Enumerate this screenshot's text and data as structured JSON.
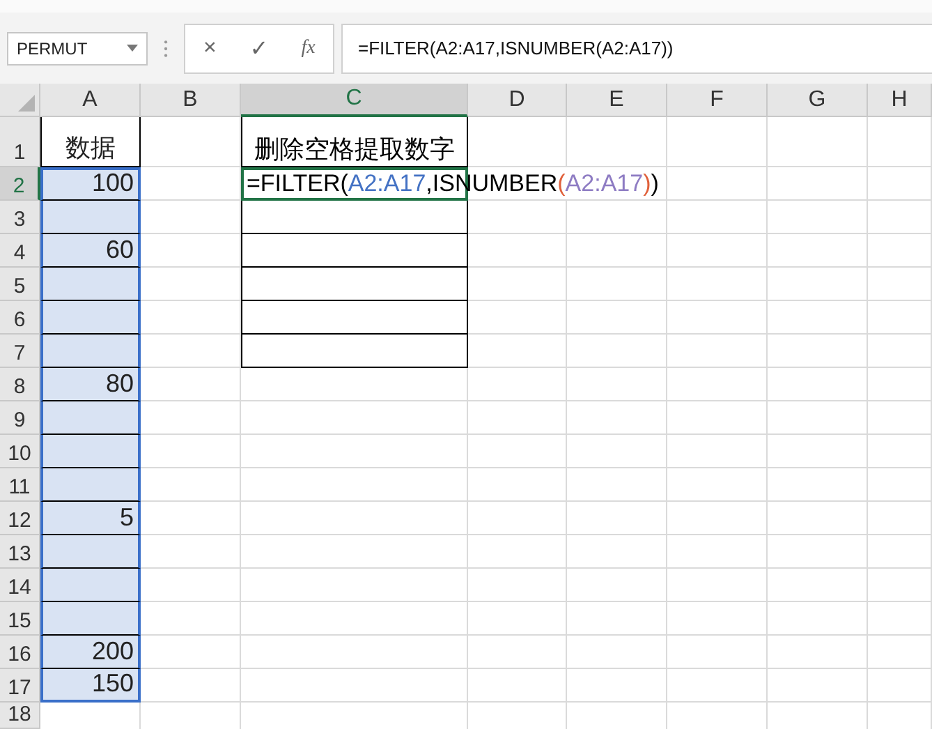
{
  "formula_bar": {
    "name_box": "PERMUT",
    "cancel": "×",
    "enter": "✓",
    "function": "fx",
    "formula": "=FILTER(A2:A17,ISNUMBER(A2:A17))"
  },
  "columns": [
    {
      "label": "A",
      "selected": false
    },
    {
      "label": "B",
      "selected": false
    },
    {
      "label": "C",
      "selected": true
    },
    {
      "label": "D",
      "selected": false
    },
    {
      "label": "E",
      "selected": false
    },
    {
      "label": "F",
      "selected": false
    },
    {
      "label": "G",
      "selected": false
    },
    {
      "label": "H",
      "selected": false
    }
  ],
  "rows": [
    {
      "label": "1",
      "selected": false,
      "in_selection": false,
      "a_bordered": true,
      "c_bordered": true,
      "c_active": false,
      "column_a": "数据",
      "column_c": [
        {
          "text": "删除空格提取数字",
          "color": "#000000"
        }
      ]
    },
    {
      "label": "2",
      "selected": true,
      "in_selection": true,
      "a_bordered": true,
      "c_bordered": true,
      "c_active": true,
      "column_a": "100",
      "column_c": [
        {
          "text": "=FILTER(",
          "color": "#000000"
        },
        {
          "text": "A2:A17",
          "color": "#4472c4"
        },
        {
          "text": ",ISNUMBER",
          "color": "#000000"
        },
        {
          "text": "(",
          "color": "#e0603a"
        },
        {
          "text": "A2:A17",
          "color": "#8e7cc3"
        },
        {
          "text": ")",
          "color": "#e0603a"
        },
        {
          "text": ")",
          "color": "#000000"
        }
      ]
    },
    {
      "label": "3",
      "selected": false,
      "in_selection": true,
      "a_bordered": true,
      "c_bordered": true,
      "c_active": false
    },
    {
      "label": "4",
      "selected": false,
      "in_selection": true,
      "a_bordered": true,
      "c_bordered": true,
      "c_active": false,
      "column_a": "60"
    },
    {
      "label": "5",
      "selected": false,
      "in_selection": true,
      "a_bordered": true,
      "c_bordered": true,
      "c_active": false
    },
    {
      "label": "6",
      "selected": false,
      "in_selection": true,
      "a_bordered": true,
      "c_bordered": true,
      "c_active": false
    },
    {
      "label": "7",
      "selected": false,
      "in_selection": true,
      "a_bordered": true,
      "c_bordered": true,
      "c_active": false
    },
    {
      "label": "8",
      "selected": false,
      "in_selection": true,
      "a_bordered": true,
      "c_bordered": false,
      "c_active": false,
      "column_a": "80"
    },
    {
      "label": "9",
      "selected": false,
      "in_selection": true,
      "a_bordered": true,
      "c_bordered": false,
      "c_active": false
    },
    {
      "label": "10",
      "selected": false,
      "in_selection": true,
      "a_bordered": true,
      "c_bordered": false,
      "c_active": false
    },
    {
      "label": "11",
      "selected": false,
      "in_selection": true,
      "a_bordered": true,
      "c_bordered": false,
      "c_active": false
    },
    {
      "label": "12",
      "selected": false,
      "in_selection": true,
      "a_bordered": true,
      "c_bordered": false,
      "c_active": false,
      "column_a": "5"
    },
    {
      "label": "13",
      "selected": false,
      "in_selection": true,
      "a_bordered": true,
      "c_bordered": false,
      "c_active": false
    },
    {
      "label": "14",
      "selected": false,
      "in_selection": true,
      "a_bordered": true,
      "c_bordered": false,
      "c_active": false
    },
    {
      "label": "15",
      "selected": false,
      "in_selection": true,
      "a_bordered": true,
      "c_bordered": false,
      "c_active": false
    },
    {
      "label": "16",
      "selected": false,
      "in_selection": true,
      "a_bordered": true,
      "c_bordered": false,
      "c_active": false,
      "column_a": "200"
    },
    {
      "label": "17",
      "selected": false,
      "in_selection": true,
      "a_bordered": true,
      "c_bordered": false,
      "c_active": false,
      "column_a": "150"
    },
    {
      "label": "18",
      "selected": false,
      "in_selection": false,
      "a_bordered": false,
      "c_bordered": false,
      "c_active": false
    }
  ]
}
